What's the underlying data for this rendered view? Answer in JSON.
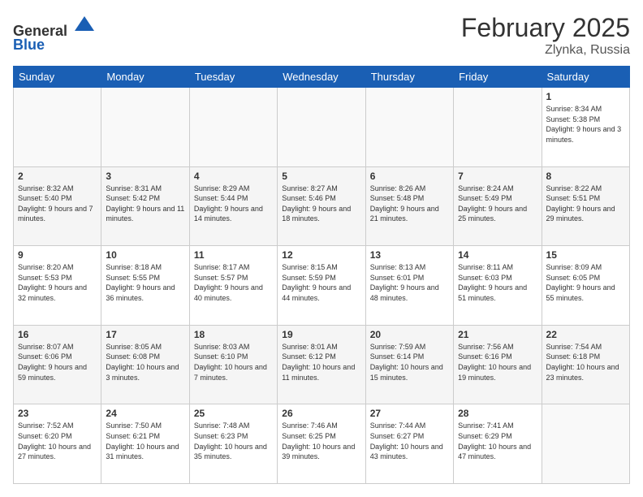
{
  "header": {
    "logo_line1": "General",
    "logo_line2": "Blue",
    "month_year": "February 2025",
    "location": "Zlynka, Russia"
  },
  "weekdays": [
    "Sunday",
    "Monday",
    "Tuesday",
    "Wednesday",
    "Thursday",
    "Friday",
    "Saturday"
  ],
  "weeks": [
    [
      {
        "day": "",
        "info": ""
      },
      {
        "day": "",
        "info": ""
      },
      {
        "day": "",
        "info": ""
      },
      {
        "day": "",
        "info": ""
      },
      {
        "day": "",
        "info": ""
      },
      {
        "day": "",
        "info": ""
      },
      {
        "day": "1",
        "info": "Sunrise: 8:34 AM\nSunset: 5:38 PM\nDaylight: 9 hours and 3 minutes."
      }
    ],
    [
      {
        "day": "2",
        "info": "Sunrise: 8:32 AM\nSunset: 5:40 PM\nDaylight: 9 hours and 7 minutes."
      },
      {
        "day": "3",
        "info": "Sunrise: 8:31 AM\nSunset: 5:42 PM\nDaylight: 9 hours and 11 minutes."
      },
      {
        "day": "4",
        "info": "Sunrise: 8:29 AM\nSunset: 5:44 PM\nDaylight: 9 hours and 14 minutes."
      },
      {
        "day": "5",
        "info": "Sunrise: 8:27 AM\nSunset: 5:46 PM\nDaylight: 9 hours and 18 minutes."
      },
      {
        "day": "6",
        "info": "Sunrise: 8:26 AM\nSunset: 5:48 PM\nDaylight: 9 hours and 21 minutes."
      },
      {
        "day": "7",
        "info": "Sunrise: 8:24 AM\nSunset: 5:49 PM\nDaylight: 9 hours and 25 minutes."
      },
      {
        "day": "8",
        "info": "Sunrise: 8:22 AM\nSunset: 5:51 PM\nDaylight: 9 hours and 29 minutes."
      }
    ],
    [
      {
        "day": "9",
        "info": "Sunrise: 8:20 AM\nSunset: 5:53 PM\nDaylight: 9 hours and 32 minutes."
      },
      {
        "day": "10",
        "info": "Sunrise: 8:18 AM\nSunset: 5:55 PM\nDaylight: 9 hours and 36 minutes."
      },
      {
        "day": "11",
        "info": "Sunrise: 8:17 AM\nSunset: 5:57 PM\nDaylight: 9 hours and 40 minutes."
      },
      {
        "day": "12",
        "info": "Sunrise: 8:15 AM\nSunset: 5:59 PM\nDaylight: 9 hours and 44 minutes."
      },
      {
        "day": "13",
        "info": "Sunrise: 8:13 AM\nSunset: 6:01 PM\nDaylight: 9 hours and 48 minutes."
      },
      {
        "day": "14",
        "info": "Sunrise: 8:11 AM\nSunset: 6:03 PM\nDaylight: 9 hours and 51 minutes."
      },
      {
        "day": "15",
        "info": "Sunrise: 8:09 AM\nSunset: 6:05 PM\nDaylight: 9 hours and 55 minutes."
      }
    ],
    [
      {
        "day": "16",
        "info": "Sunrise: 8:07 AM\nSunset: 6:06 PM\nDaylight: 9 hours and 59 minutes."
      },
      {
        "day": "17",
        "info": "Sunrise: 8:05 AM\nSunset: 6:08 PM\nDaylight: 10 hours and 3 minutes."
      },
      {
        "day": "18",
        "info": "Sunrise: 8:03 AM\nSunset: 6:10 PM\nDaylight: 10 hours and 7 minutes."
      },
      {
        "day": "19",
        "info": "Sunrise: 8:01 AM\nSunset: 6:12 PM\nDaylight: 10 hours and 11 minutes."
      },
      {
        "day": "20",
        "info": "Sunrise: 7:59 AM\nSunset: 6:14 PM\nDaylight: 10 hours and 15 minutes."
      },
      {
        "day": "21",
        "info": "Sunrise: 7:56 AM\nSunset: 6:16 PM\nDaylight: 10 hours and 19 minutes."
      },
      {
        "day": "22",
        "info": "Sunrise: 7:54 AM\nSunset: 6:18 PM\nDaylight: 10 hours and 23 minutes."
      }
    ],
    [
      {
        "day": "23",
        "info": "Sunrise: 7:52 AM\nSunset: 6:20 PM\nDaylight: 10 hours and 27 minutes."
      },
      {
        "day": "24",
        "info": "Sunrise: 7:50 AM\nSunset: 6:21 PM\nDaylight: 10 hours and 31 minutes."
      },
      {
        "day": "25",
        "info": "Sunrise: 7:48 AM\nSunset: 6:23 PM\nDaylight: 10 hours and 35 minutes."
      },
      {
        "day": "26",
        "info": "Sunrise: 7:46 AM\nSunset: 6:25 PM\nDaylight: 10 hours and 39 minutes."
      },
      {
        "day": "27",
        "info": "Sunrise: 7:44 AM\nSunset: 6:27 PM\nDaylight: 10 hours and 43 minutes."
      },
      {
        "day": "28",
        "info": "Sunrise: 7:41 AM\nSunset: 6:29 PM\nDaylight: 10 hours and 47 minutes."
      },
      {
        "day": "",
        "info": ""
      }
    ]
  ]
}
